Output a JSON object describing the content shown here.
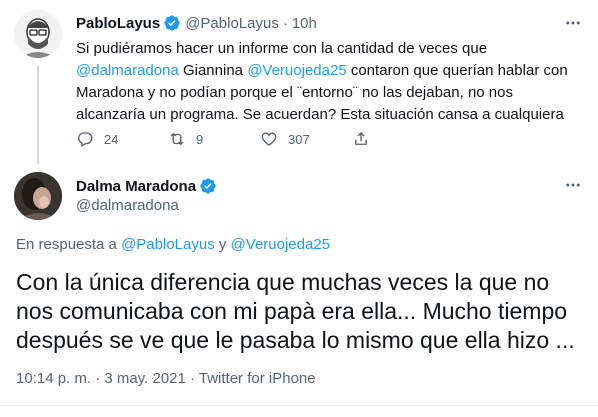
{
  "parent": {
    "display_name": "PabloLayus",
    "handle": "@PabloLayus",
    "separator": "·",
    "time": "10h",
    "body_text_1": "Si pudiéramos hacer un informe con la cantidad de veces que ",
    "mention_1": "@dalmaradona",
    "body_text_2": " Giannina ",
    "mention_2": "@Veruojeda25",
    "body_text_3": " contaron que querían hablar con Maradona y no podían porque el ¨entorno¨ no las dejaban, no nos alcanzaría un programa. Se acuerdan? Esta situación cansa a cualquiera",
    "replies": "24",
    "retweets": "9",
    "likes": "307"
  },
  "main": {
    "display_name": "Dalma Maradona",
    "handle": "@dalmaradona",
    "reply_prefix": "En respuesta a ",
    "reply_mention_1": "@PabloLayus",
    "reply_and": " y ",
    "reply_mention_2": "@Veruojeda25",
    "body": "Con la única diferencia que muchas veces la que no nos comunicaba con mi papà era ella...  Mucho tiempo después se ve que le pasaba lo mismo que ella hizo ...",
    "timestamp": "10:14 p. m. · 3 may. 2021 · Twitter for iPhone"
  },
  "colors": {
    "accent": "#1d9bf0",
    "muted": "#536471",
    "text": "#0f1419"
  },
  "icons": {
    "verified": "verified-badge-icon",
    "more": "more-options-icon",
    "reply": "reply-icon",
    "retweet": "retweet-icon",
    "like": "heart-icon",
    "share": "share-icon"
  }
}
